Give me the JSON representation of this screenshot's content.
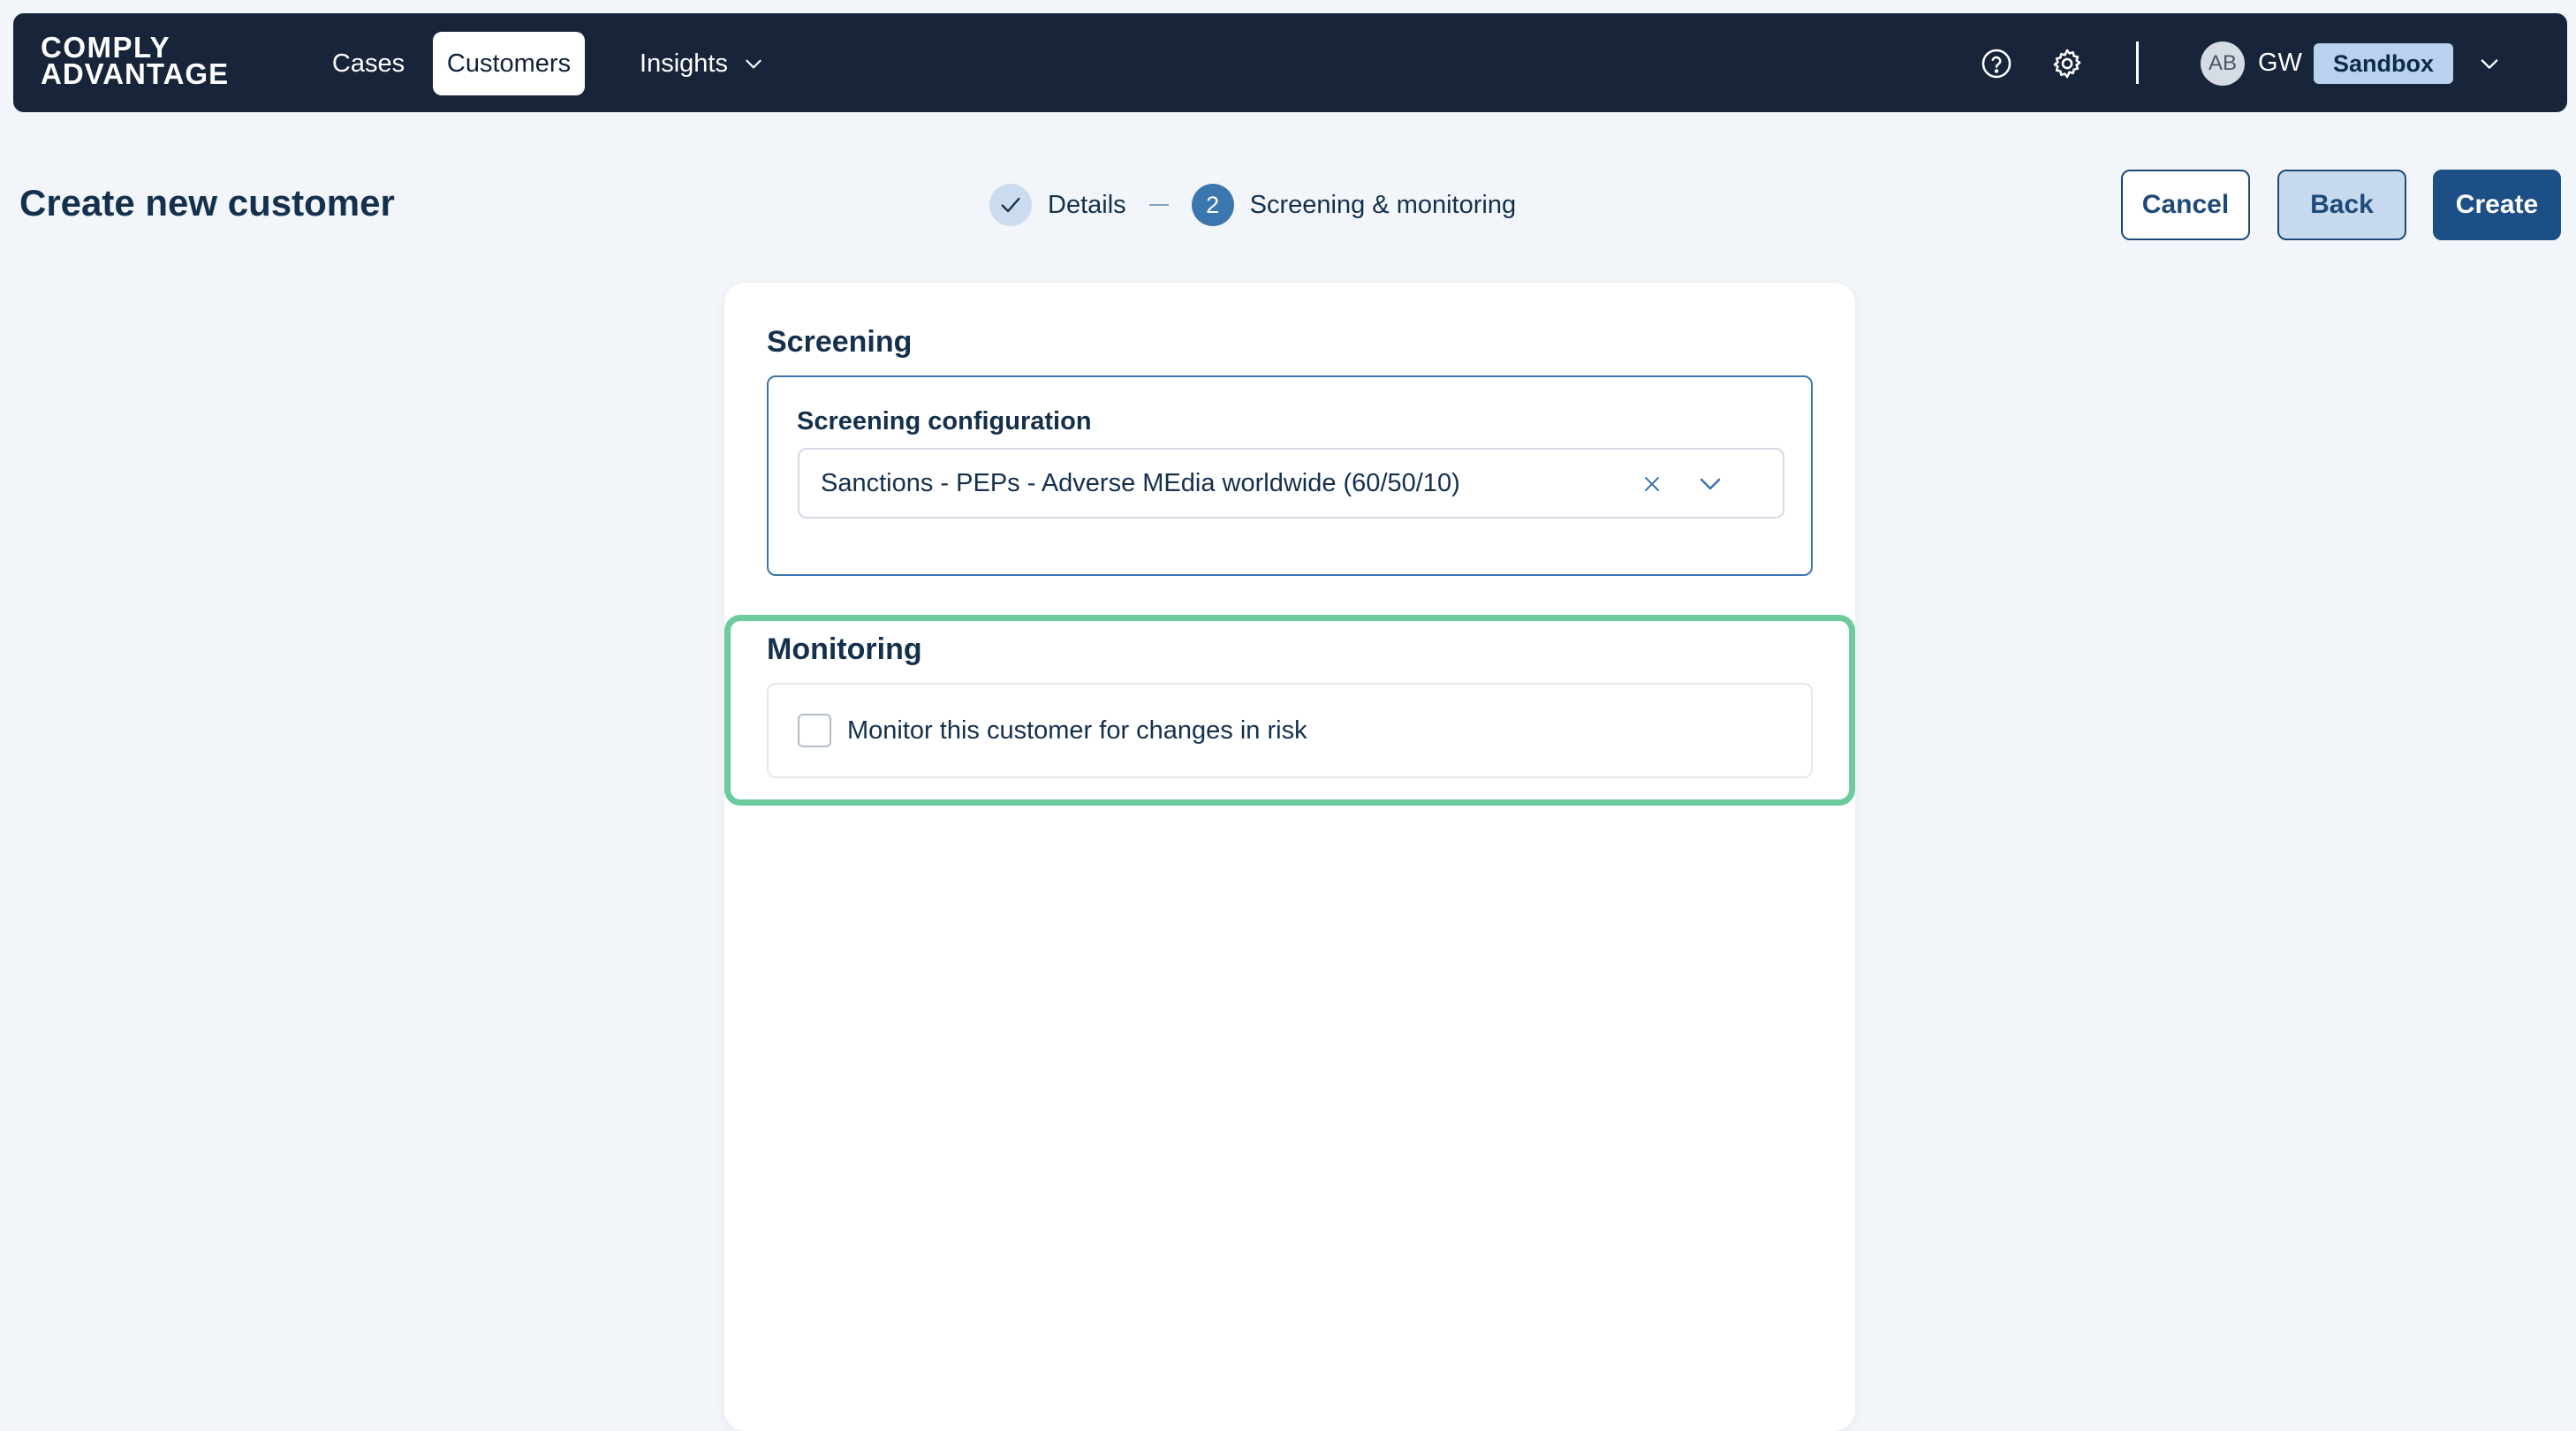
{
  "brand": {
    "line1": "COMPLY",
    "line2": "ADVANTAGE"
  },
  "nav": {
    "items": [
      {
        "label": "Cases"
      },
      {
        "label": "Customers"
      },
      {
        "label": "Insights"
      }
    ],
    "help_icon": "help-circle-icon",
    "settings_icon": "gear-icon",
    "user": {
      "avatar_initials": "AB",
      "initials": "GW",
      "environment_badge": "Sandbox"
    }
  },
  "header": {
    "title": "Create new customer",
    "steps": [
      {
        "label": "Details",
        "state": "completed"
      },
      {
        "number": "2",
        "label": "Screening & monitoring",
        "state": "active"
      }
    ],
    "buttons": {
      "cancel": "Cancel",
      "back": "Back",
      "create": "Create"
    }
  },
  "screening": {
    "title": "Screening",
    "config_label": "Screening configuration",
    "config_value": "Sanctions - PEPs - Adverse MEdia worldwide (60/50/10)"
  },
  "monitoring": {
    "title": "Monitoring",
    "checkbox_label": "Monitor this customer for changes in risk",
    "checked": false
  },
  "colors": {
    "navbar": "#18243a",
    "primary": "#1c4f85",
    "active_step": "#3b76ae",
    "highlight": "#6ccb9d",
    "page_background": "#f2f5f9"
  }
}
